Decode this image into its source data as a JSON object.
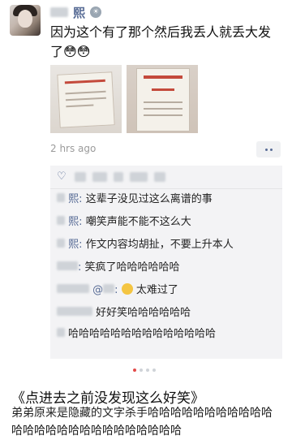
{
  "post": {
    "username": "熙",
    "text": "因为这个有了那个然后我丢人就丢大发了😳😳",
    "time": "2 hrs ago"
  },
  "comments": [
    {
      "name": "熙",
      "text": "这辈子没见过这么离谱的事"
    },
    {
      "name": "熙",
      "text": "嘲笑声能不能不这么大"
    },
    {
      "name": "熙",
      "text": "作文内容均胡扯，不要上升本人"
    },
    {
      "name": "",
      "text": "笑疯了哈哈哈哈哈哈"
    },
    {
      "name": "",
      "mention": "@",
      "text": "太难过了"
    },
    {
      "name": "",
      "text": "好好笑哈哈哈哈哈哈"
    },
    {
      "name": "",
      "text": "哈哈哈哈哈哈哈哈哈哈哈哈哈哈"
    }
  ],
  "carousel": {
    "total": 4,
    "active": 0
  },
  "article": {
    "title": "《点进去之前没发现这么好笑》",
    "body": "弟弟原来是隐藏的文字杀手哈哈哈哈哈哈哈哈哈哈哈哈哈哈哈哈哈哈哈哈哈哈哈哈哈哈"
  },
  "colors": {
    "link": "#576b95",
    "background": "#ffffff",
    "comment_bg": "#f3f3f5"
  }
}
